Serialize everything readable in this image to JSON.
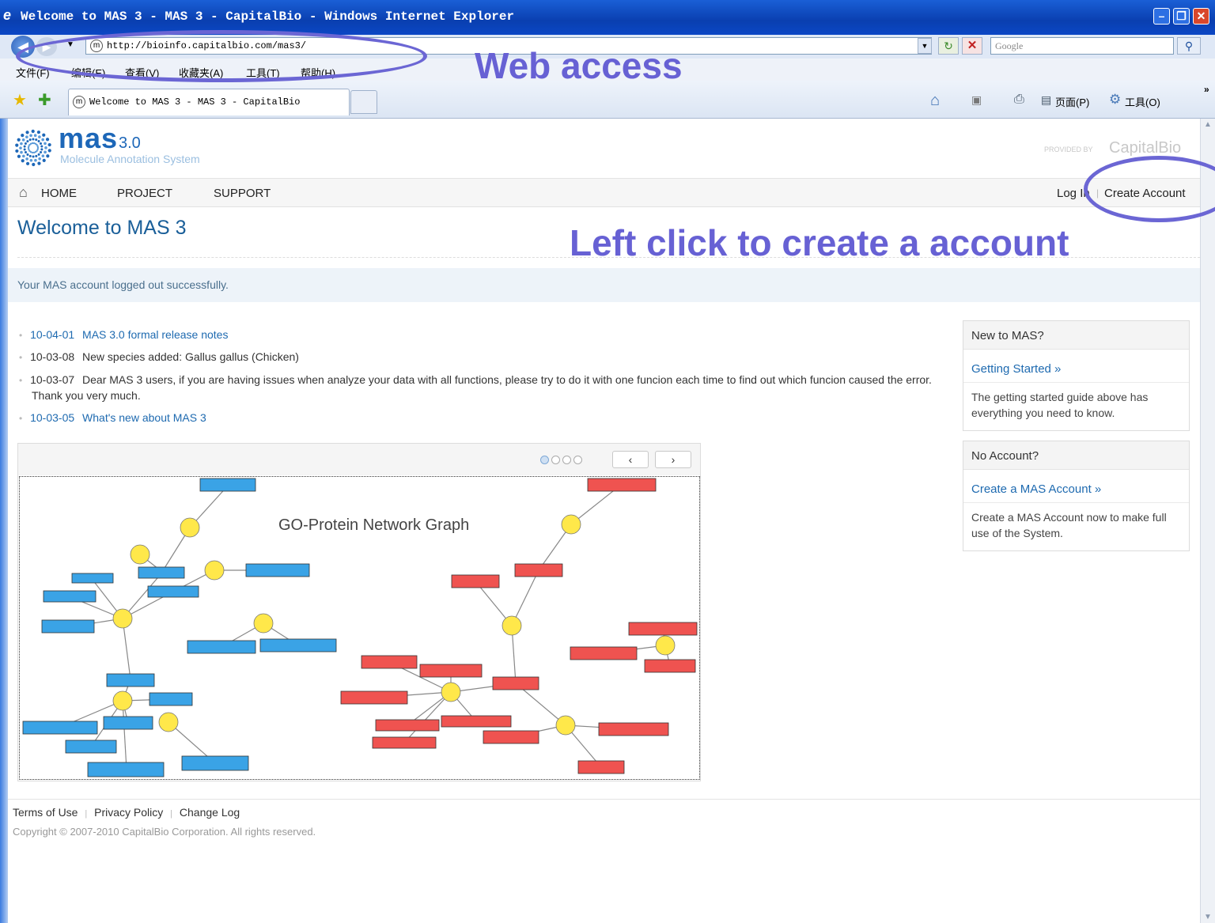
{
  "browser": {
    "window_title": "Welcome to MAS 3 - MAS 3 - CapitalBio - Windows Internet Explorer",
    "address": "http://bioinfo.capitalbio.com/mas3/",
    "search_placeholder": "Google",
    "menu": [
      "文件(F)",
      "编辑(E)",
      "查看(V)",
      "收藏夹(A)",
      "工具(T)",
      "帮助(H)"
    ],
    "tab_title": "Welcome to MAS 3 - MAS 3 - CapitalBio",
    "toolbar_page": "页面(P)",
    "toolbar_tools": "工具(O)"
  },
  "annotations": {
    "web_access": "Web access",
    "create_hint": "Left click to create a account"
  },
  "site": {
    "logo_name": "mas",
    "logo_version": "3.0",
    "logo_subtitle": "Molecule Annotation System",
    "provider_prefix": "PROVIDED BY",
    "provider_name": "CapitalBio"
  },
  "nav": {
    "home": "HOME",
    "project": "PROJECT",
    "support": "SUPPORT",
    "login": "Log In",
    "create_account": "Create Account"
  },
  "page": {
    "title": "Welcome to MAS 3",
    "notice": "Your MAS account logged out successfully."
  },
  "news": [
    {
      "date": "10-04-01",
      "text": "MAS 3.0 formal release notes",
      "link": true
    },
    {
      "date": "10-03-08",
      "text": "New species added: Gallus gallus (Chicken)",
      "link": false
    },
    {
      "date": "10-03-07",
      "text": "Dear MAS 3 users, if you are having issues when analyze your data with all functions, please try to do it with one funcion each time to find out which funcion caused the error. Thank you very much.",
      "link": false
    },
    {
      "date": "10-03-05",
      "text": "What's new about MAS 3",
      "link": true
    }
  ],
  "sidebar": {
    "new_box": {
      "title": "New to MAS?",
      "link": "Getting Started »",
      "text": "The getting started guide above has everything you need to know."
    },
    "account_box": {
      "title": "No Account?",
      "link": "Create a MAS Account »",
      "text": "Create a MAS Account now to make full use of the System."
    }
  },
  "carousel": {
    "prev": "‹",
    "next": "›",
    "dots": 4,
    "active_dot": 1,
    "graph_title": "GO-Protein Network Graph"
  },
  "footer": {
    "links": [
      "Terms of Use",
      "Privacy Policy",
      "Change Log"
    ],
    "copyright": "Copyright © 2007-2010 CapitalBio Corporation. All rights reserved."
  }
}
